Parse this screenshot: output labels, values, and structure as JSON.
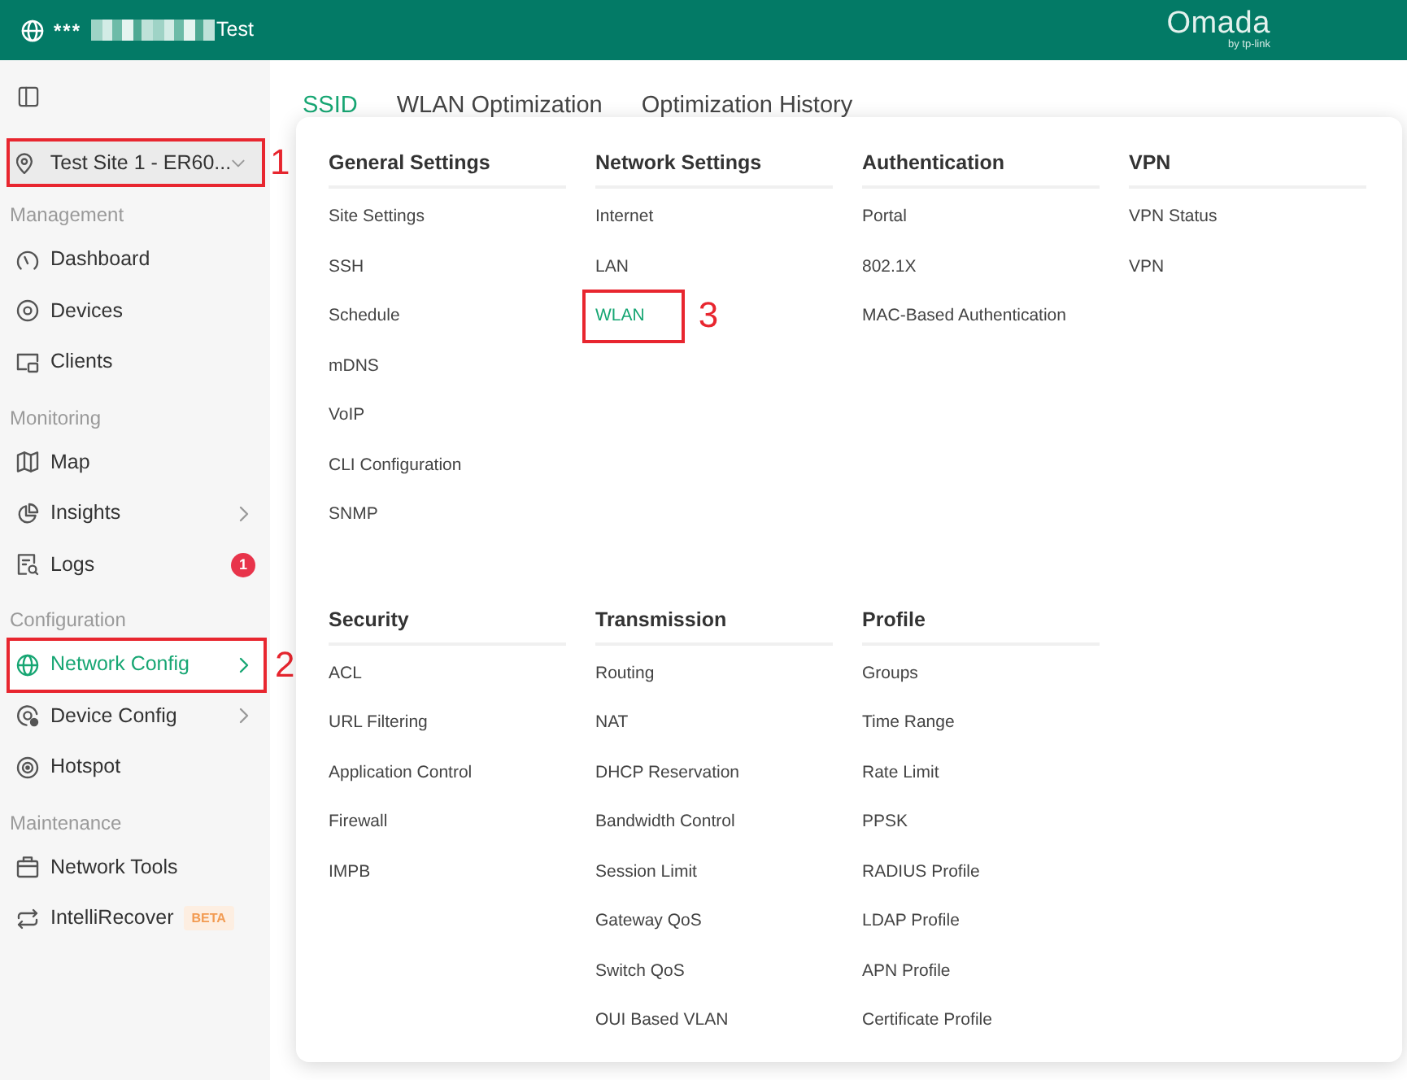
{
  "header": {
    "title_prefix": "***",
    "title_suffix": "Test",
    "logo": "Omada",
    "logo_tagline": "by tp-link"
  },
  "sidebar": {
    "site_selector": {
      "label": "Test Site 1 - ER60...",
      "callout": "1"
    },
    "sections": [
      {
        "title": "Management",
        "items": [
          {
            "label": "Dashboard",
            "selected": false,
            "submenu": false
          },
          {
            "label": "Devices",
            "selected": false,
            "submenu": false
          },
          {
            "label": "Clients",
            "selected": false,
            "submenu": false
          }
        ]
      },
      {
        "title": "Monitoring",
        "items": [
          {
            "label": "Map",
            "selected": false,
            "submenu": false
          },
          {
            "label": "Insights",
            "selected": false,
            "submenu": true
          },
          {
            "label": "Logs",
            "selected": false,
            "submenu": false,
            "count": "1"
          }
        ]
      },
      {
        "title": "Configuration",
        "items": [
          {
            "label": "Network Config",
            "selected": true,
            "submenu": true,
            "callout": "2"
          },
          {
            "label": "Device Config",
            "selected": false,
            "submenu": true
          },
          {
            "label": "Hotspot",
            "selected": false,
            "submenu": false
          }
        ]
      },
      {
        "title": "Maintenance",
        "items": [
          {
            "label": "Network Tools",
            "selected": false,
            "submenu": false
          },
          {
            "label": "IntelliRecover",
            "selected": false,
            "submenu": false,
            "tag": "BETA"
          }
        ]
      }
    ]
  },
  "tabs": [
    {
      "label": "SSID",
      "selected": true
    },
    {
      "label": "WLAN Optimization",
      "selected": false
    },
    {
      "label": "Optimization History",
      "selected": false
    }
  ],
  "menu": {
    "groups": [
      {
        "title": "General Settings",
        "items": [
          {
            "label": "Site Settings",
            "selected": false
          },
          {
            "label": "SSH",
            "selected": false
          },
          {
            "label": "Schedule",
            "selected": false
          },
          {
            "label": "mDNS",
            "selected": false
          },
          {
            "label": "VoIP",
            "selected": false
          },
          {
            "label": "CLI Configuration",
            "selected": false
          },
          {
            "label": "SNMP",
            "selected": false
          }
        ]
      },
      {
        "title": "Network Settings",
        "items": [
          {
            "label": "Internet",
            "selected": false
          },
          {
            "label": "LAN",
            "selected": false
          },
          {
            "label": "WLAN",
            "selected": true,
            "callout": "3"
          }
        ]
      },
      {
        "title": "Authentication",
        "items": [
          {
            "label": "Portal",
            "selected": false
          },
          {
            "label": "802.1X",
            "selected": false
          },
          {
            "label": "MAC-Based Authentication",
            "selected": false
          }
        ]
      },
      {
        "title": "VPN",
        "items": [
          {
            "label": "VPN Status",
            "selected": false
          },
          {
            "label": "VPN",
            "selected": false
          }
        ]
      },
      {
        "title": "Security",
        "items": [
          {
            "label": "ACL",
            "selected": false
          },
          {
            "label": "URL Filtering",
            "selected": false
          },
          {
            "label": "Application Control",
            "selected": false
          },
          {
            "label": "Firewall",
            "selected": false
          },
          {
            "label": "IMPB",
            "selected": false
          }
        ]
      },
      {
        "title": "Transmission",
        "items": [
          {
            "label": "Routing",
            "selected": false
          },
          {
            "label": "NAT",
            "selected": false
          },
          {
            "label": "DHCP Reservation",
            "selected": false
          },
          {
            "label": "Bandwidth Control",
            "selected": false
          },
          {
            "label": "Session Limit",
            "selected": false
          },
          {
            "label": "Gateway QoS",
            "selected": false
          },
          {
            "label": "Switch QoS",
            "selected": false
          },
          {
            "label": "OUI Based VLAN",
            "selected": false
          }
        ]
      },
      {
        "title": "Profile",
        "items": [
          {
            "label": "Groups",
            "selected": false
          },
          {
            "label": "Time Range",
            "selected": false
          },
          {
            "label": "Rate Limit",
            "selected": false
          },
          {
            "label": "PPSK",
            "selected": false
          },
          {
            "label": "RADIUS Profile",
            "selected": false
          },
          {
            "label": "LDAP Profile",
            "selected": false
          },
          {
            "label": "APN Profile",
            "selected": false
          },
          {
            "label": "Certificate Profile",
            "selected": false
          }
        ]
      }
    ]
  }
}
